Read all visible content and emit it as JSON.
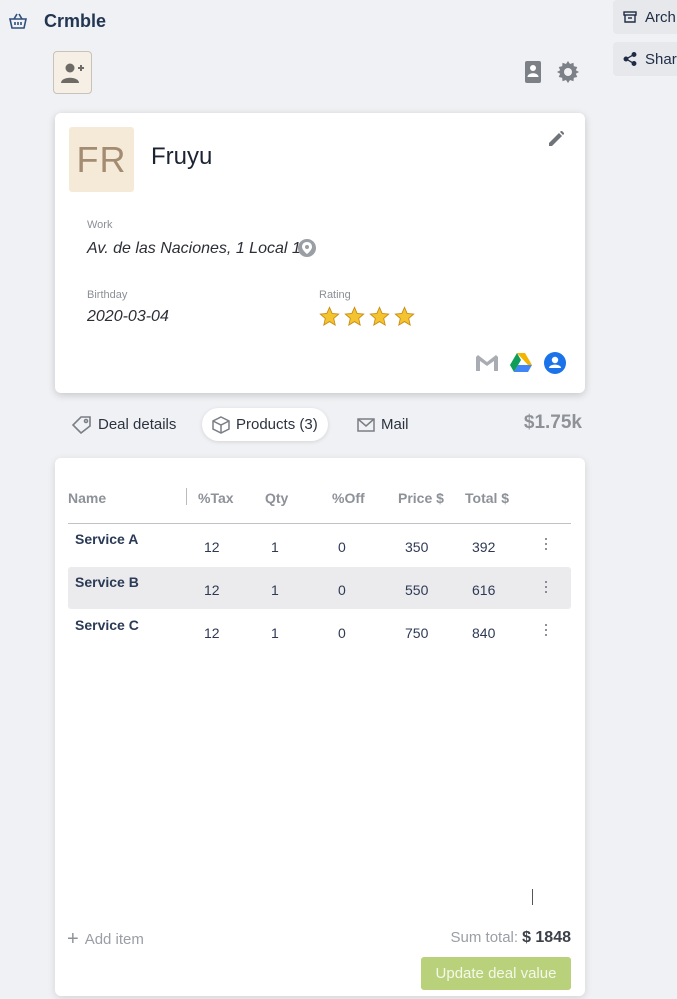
{
  "app": {
    "title": "Crmble",
    "icon": "basket-icon"
  },
  "side_actions": [
    {
      "label": "Arch",
      "icon": "archive-icon"
    },
    {
      "label": "Shar",
      "icon": "share-icon"
    }
  ],
  "toolbar": {
    "add_contact_icon": "person-add-icon",
    "contact_card_icon": "contact-book-icon",
    "settings_icon": "gear-icon"
  },
  "contact": {
    "initials": "FR",
    "name": "Fruyu",
    "work_label": "Work",
    "work_value": "Av. de las Naciones, 1 Local 1",
    "birthday_label": "Birthday",
    "birthday_value": "2020-03-04",
    "rating_label": "Rating",
    "rating": 4,
    "rating_max": 4,
    "integrations": [
      "gmail-icon",
      "google-drive-icon",
      "contacts-icon"
    ]
  },
  "tabs": [
    {
      "label": "Deal details",
      "icon": "tag-icon",
      "active": false
    },
    {
      "label": "Products (3)",
      "icon": "box-icon",
      "active": true
    },
    {
      "label": "Mail",
      "icon": "mail-icon",
      "active": false
    }
  ],
  "deal_value": "$1.75k",
  "products": {
    "columns": [
      "Name",
      "%Tax",
      "Qty",
      "%Off",
      "Price $",
      "Total $"
    ],
    "rows": [
      {
        "name": "Service A",
        "tax": "12",
        "qty": "1",
        "off": "0",
        "price": "350",
        "total": "392"
      },
      {
        "name": "Service B",
        "tax": "12",
        "qty": "1",
        "off": "0",
        "price": "550",
        "total": "616"
      },
      {
        "name": "Service C",
        "tax": "12",
        "qty": "1",
        "off": "0",
        "price": "750",
        "total": "840"
      }
    ],
    "add_item_label": "Add item",
    "sum_label": "Sum total:",
    "sum_value": "$ 1848",
    "update_button": "Update deal value"
  },
  "colors": {
    "accent_button": "#b9d17a",
    "avatar_bg": "#f5ead8",
    "star": "#f4c430"
  }
}
